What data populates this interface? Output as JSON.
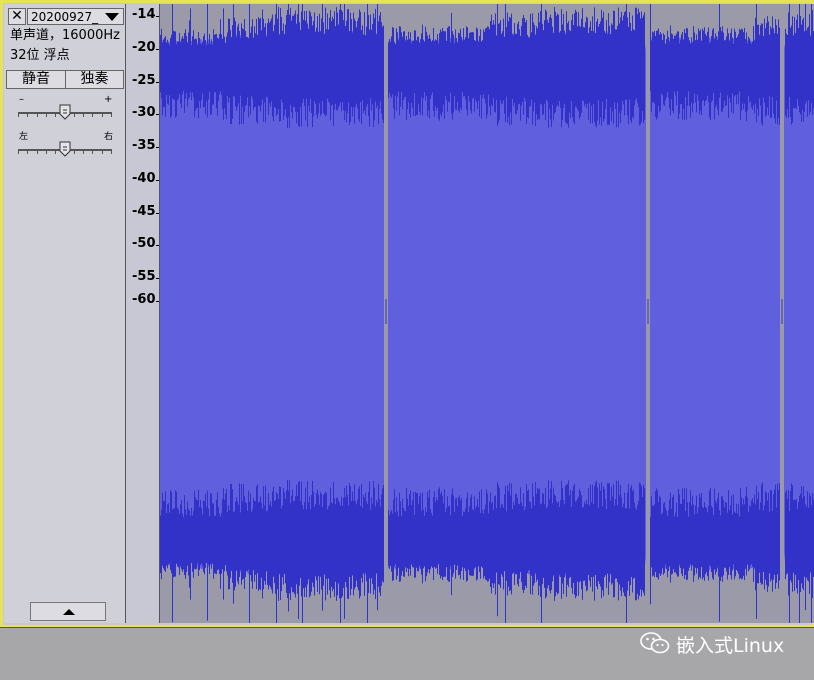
{
  "track": {
    "name": "20200927_",
    "channel_info": "单声道，16000Hz",
    "format_info": "32位 浮点",
    "mute_label": "静音",
    "solo_label": "独奏",
    "close_glyph": "✕",
    "gain_min": "–",
    "gain_max": "+",
    "pan_left": "左",
    "pan_right": "右",
    "gain_value": 0.5,
    "pan_value": 0.5
  },
  "ruler": {
    "labels": [
      "-14",
      "-20",
      "-25",
      "-30",
      "-35",
      "-40",
      "-45",
      "-50",
      "-55",
      "-60"
    ]
  },
  "waveform": {
    "color_fill": "#6060de",
    "color_peak": "#3232c8",
    "background": "#9a9aa8"
  },
  "watermark": {
    "text": "嵌入式Linux",
    "icon": "wechat-icon"
  },
  "colors": {
    "track_border": "#e6e25a",
    "panel": "#d0d0d8",
    "app_bg": "#a7a7a9"
  }
}
